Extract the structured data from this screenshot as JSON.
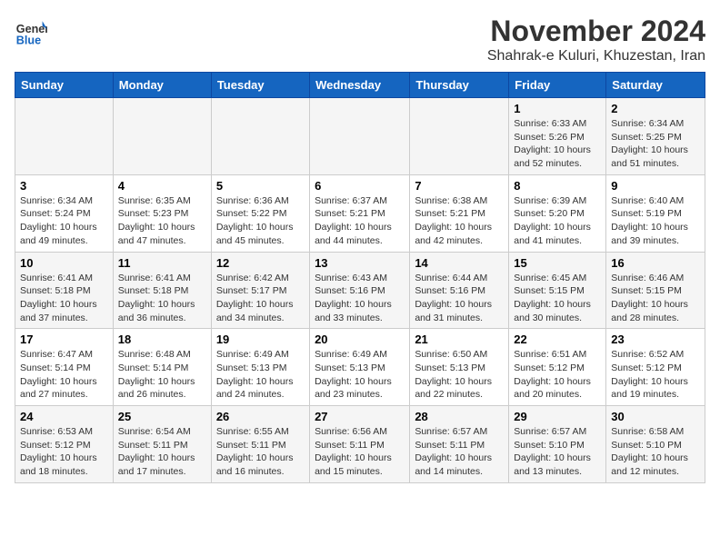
{
  "header": {
    "logo_line1": "General",
    "logo_line2": "Blue",
    "month": "November 2024",
    "location": "Shahrak-e Kuluri, Khuzestan, Iran"
  },
  "days_of_week": [
    "Sunday",
    "Monday",
    "Tuesday",
    "Wednesday",
    "Thursday",
    "Friday",
    "Saturday"
  ],
  "weeks": [
    [
      {
        "day": "",
        "info": ""
      },
      {
        "day": "",
        "info": ""
      },
      {
        "day": "",
        "info": ""
      },
      {
        "day": "",
        "info": ""
      },
      {
        "day": "",
        "info": ""
      },
      {
        "day": "1",
        "info": "Sunrise: 6:33 AM\nSunset: 5:26 PM\nDaylight: 10 hours\nand 52 minutes."
      },
      {
        "day": "2",
        "info": "Sunrise: 6:34 AM\nSunset: 5:25 PM\nDaylight: 10 hours\nand 51 minutes."
      }
    ],
    [
      {
        "day": "3",
        "info": "Sunrise: 6:34 AM\nSunset: 5:24 PM\nDaylight: 10 hours\nand 49 minutes."
      },
      {
        "day": "4",
        "info": "Sunrise: 6:35 AM\nSunset: 5:23 PM\nDaylight: 10 hours\nand 47 minutes."
      },
      {
        "day": "5",
        "info": "Sunrise: 6:36 AM\nSunset: 5:22 PM\nDaylight: 10 hours\nand 45 minutes."
      },
      {
        "day": "6",
        "info": "Sunrise: 6:37 AM\nSunset: 5:21 PM\nDaylight: 10 hours\nand 44 minutes."
      },
      {
        "day": "7",
        "info": "Sunrise: 6:38 AM\nSunset: 5:21 PM\nDaylight: 10 hours\nand 42 minutes."
      },
      {
        "day": "8",
        "info": "Sunrise: 6:39 AM\nSunset: 5:20 PM\nDaylight: 10 hours\nand 41 minutes."
      },
      {
        "day": "9",
        "info": "Sunrise: 6:40 AM\nSunset: 5:19 PM\nDaylight: 10 hours\nand 39 minutes."
      }
    ],
    [
      {
        "day": "10",
        "info": "Sunrise: 6:41 AM\nSunset: 5:18 PM\nDaylight: 10 hours\nand 37 minutes."
      },
      {
        "day": "11",
        "info": "Sunrise: 6:41 AM\nSunset: 5:18 PM\nDaylight: 10 hours\nand 36 minutes."
      },
      {
        "day": "12",
        "info": "Sunrise: 6:42 AM\nSunset: 5:17 PM\nDaylight: 10 hours\nand 34 minutes."
      },
      {
        "day": "13",
        "info": "Sunrise: 6:43 AM\nSunset: 5:16 PM\nDaylight: 10 hours\nand 33 minutes."
      },
      {
        "day": "14",
        "info": "Sunrise: 6:44 AM\nSunset: 5:16 PM\nDaylight: 10 hours\nand 31 minutes."
      },
      {
        "day": "15",
        "info": "Sunrise: 6:45 AM\nSunset: 5:15 PM\nDaylight: 10 hours\nand 30 minutes."
      },
      {
        "day": "16",
        "info": "Sunrise: 6:46 AM\nSunset: 5:15 PM\nDaylight: 10 hours\nand 28 minutes."
      }
    ],
    [
      {
        "day": "17",
        "info": "Sunrise: 6:47 AM\nSunset: 5:14 PM\nDaylight: 10 hours\nand 27 minutes."
      },
      {
        "day": "18",
        "info": "Sunrise: 6:48 AM\nSunset: 5:14 PM\nDaylight: 10 hours\nand 26 minutes."
      },
      {
        "day": "19",
        "info": "Sunrise: 6:49 AM\nSunset: 5:13 PM\nDaylight: 10 hours\nand 24 minutes."
      },
      {
        "day": "20",
        "info": "Sunrise: 6:49 AM\nSunset: 5:13 PM\nDaylight: 10 hours\nand 23 minutes."
      },
      {
        "day": "21",
        "info": "Sunrise: 6:50 AM\nSunset: 5:13 PM\nDaylight: 10 hours\nand 22 minutes."
      },
      {
        "day": "22",
        "info": "Sunrise: 6:51 AM\nSunset: 5:12 PM\nDaylight: 10 hours\nand 20 minutes."
      },
      {
        "day": "23",
        "info": "Sunrise: 6:52 AM\nSunset: 5:12 PM\nDaylight: 10 hours\nand 19 minutes."
      }
    ],
    [
      {
        "day": "24",
        "info": "Sunrise: 6:53 AM\nSunset: 5:12 PM\nDaylight: 10 hours\nand 18 minutes."
      },
      {
        "day": "25",
        "info": "Sunrise: 6:54 AM\nSunset: 5:11 PM\nDaylight: 10 hours\nand 17 minutes."
      },
      {
        "day": "26",
        "info": "Sunrise: 6:55 AM\nSunset: 5:11 PM\nDaylight: 10 hours\nand 16 minutes."
      },
      {
        "day": "27",
        "info": "Sunrise: 6:56 AM\nSunset: 5:11 PM\nDaylight: 10 hours\nand 15 minutes."
      },
      {
        "day": "28",
        "info": "Sunrise: 6:57 AM\nSunset: 5:11 PM\nDaylight: 10 hours\nand 14 minutes."
      },
      {
        "day": "29",
        "info": "Sunrise: 6:57 AM\nSunset: 5:10 PM\nDaylight: 10 hours\nand 13 minutes."
      },
      {
        "day": "30",
        "info": "Sunrise: 6:58 AM\nSunset: 5:10 PM\nDaylight: 10 hours\nand 12 minutes."
      }
    ]
  ]
}
